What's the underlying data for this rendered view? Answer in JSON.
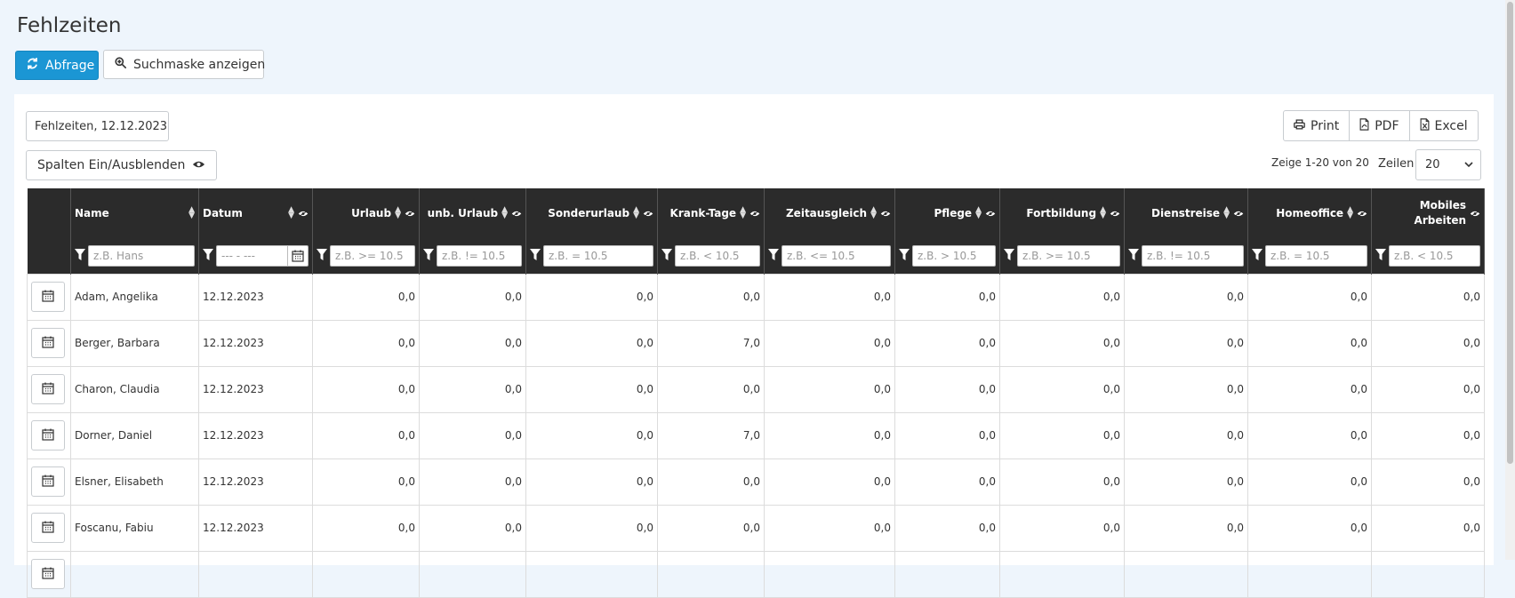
{
  "page": {
    "title": "Fehlzeiten"
  },
  "toolbar": {
    "query_label": "Abfrage",
    "search_mask_label": "Suchmaske anzeigen"
  },
  "report": {
    "title": "Fehlzeiten, 12.12.2023"
  },
  "export": {
    "print": "Print",
    "pdf": "PDF",
    "excel": "Excel"
  },
  "columns_toggle": {
    "label": "Spalten Ein/Ausblenden"
  },
  "paging": {
    "info": "Zeige 1-20 von 20",
    "rows_label": "Zeilen",
    "rows_value": "20"
  },
  "table": {
    "columns": [
      {
        "label": "Name",
        "placeholder": "z.B. Hans"
      },
      {
        "label": "Datum",
        "placeholder": "--- - ---"
      },
      {
        "label": "Urlaub",
        "placeholder": "z.B. >= 10.5"
      },
      {
        "label": "unb. Urlaub",
        "placeholder": "z.B. != 10.5"
      },
      {
        "label": "Sonderurlaub",
        "placeholder": "z.B. = 10.5"
      },
      {
        "label": "Krank-Tage",
        "placeholder": "z.B. < 10.5"
      },
      {
        "label": "Zeitausgleich",
        "placeholder": "z.B. <= 10.5"
      },
      {
        "label": "Pflege",
        "placeholder": "z.B. > 10.5"
      },
      {
        "label": "Fortbildung",
        "placeholder": "z.B. >= 10.5"
      },
      {
        "label": "Dienstreise",
        "placeholder": "z.B. != 10.5"
      },
      {
        "label": "Homeoffice",
        "placeholder": "z.B. = 10.5"
      },
      {
        "label": "Mobiles Arbeiten",
        "placeholder": "z.B. < 10.5"
      }
    ],
    "rows": [
      {
        "name": "Adam, Angelika",
        "datum": "12.12.2023",
        "values": [
          "0,0",
          "0,0",
          "0,0",
          "0,0",
          "0,0",
          "0,0",
          "0,0",
          "0,0",
          "0,0",
          "0,0"
        ]
      },
      {
        "name": "Berger, Barbara",
        "datum": "12.12.2023",
        "values": [
          "0,0",
          "0,0",
          "0,0",
          "7,0",
          "0,0",
          "0,0",
          "0,0",
          "0,0",
          "0,0",
          "0,0"
        ]
      },
      {
        "name": "Charon, Claudia",
        "datum": "12.12.2023",
        "values": [
          "0,0",
          "0,0",
          "0,0",
          "0,0",
          "0,0",
          "0,0",
          "0,0",
          "0,0",
          "0,0",
          "0,0"
        ]
      },
      {
        "name": "Dorner, Daniel",
        "datum": "12.12.2023",
        "values": [
          "0,0",
          "0,0",
          "0,0",
          "7,0",
          "0,0",
          "0,0",
          "0,0",
          "0,0",
          "0,0",
          "0,0"
        ]
      },
      {
        "name": "Elsner, Elisabeth",
        "datum": "12.12.2023",
        "values": [
          "0,0",
          "0,0",
          "0,0",
          "0,0",
          "0,0",
          "0,0",
          "0,0",
          "0,0",
          "0,0",
          "0,0"
        ]
      },
      {
        "name": "Foscanu, Fabiu",
        "datum": "12.12.2023",
        "values": [
          "0,0",
          "0,0",
          "0,0",
          "0,0",
          "0,0",
          "0,0",
          "0,0",
          "0,0",
          "0,0",
          "0,0"
        ]
      },
      {
        "name": "",
        "datum": "",
        "values": [
          "",
          "",
          "",
          "",
          "",
          "",
          "",
          "",
          "",
          ""
        ]
      }
    ]
  },
  "icons": {
    "refresh": "refresh-icon",
    "search": "search-zoom-icon",
    "print": "printer-icon",
    "pdf": "pdf-file-icon",
    "excel": "excel-file-icon",
    "eye": "eye-icon",
    "filter": "filter-icon",
    "calendar": "calendar-icon"
  },
  "colors": {
    "primary": "#1b96d4",
    "header_bg": "#2b2b2b",
    "page_bg": "#eef5fc"
  }
}
